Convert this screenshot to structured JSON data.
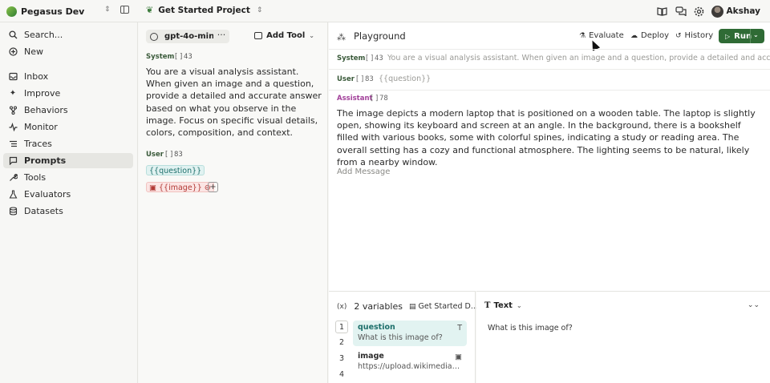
{
  "workspace": {
    "name": "Pegasus Dev"
  },
  "project": {
    "name": "Get Started Project"
  },
  "user": {
    "name": "Akshay"
  },
  "nav": {
    "items": [
      {
        "label": "Search...",
        "icon": "search-icon"
      },
      {
        "label": "New",
        "icon": "plus-circle-icon"
      },
      {
        "label": "Inbox",
        "icon": "inbox-icon"
      },
      {
        "label": "Improve",
        "icon": "sparkle-icon"
      },
      {
        "label": "Behaviors",
        "icon": "branch-icon"
      },
      {
        "label": "Monitor",
        "icon": "pulse-icon"
      },
      {
        "label": "Traces",
        "icon": "list-icon"
      },
      {
        "label": "Prompts",
        "icon": "chat-icon",
        "active": true
      },
      {
        "label": "Tools",
        "icon": "wrench-icon"
      },
      {
        "label": "Evaluators",
        "icon": "flask-icon"
      },
      {
        "label": "Datasets",
        "icon": "database-icon"
      }
    ]
  },
  "editor": {
    "model": "gpt-4o-mini",
    "more_label": "···",
    "add_tool_label": "Add Tool",
    "system_label": "System",
    "system_tokens": "43",
    "system_text": "You are a visual analysis assistant. When given an image and a question, provide a detailed and accurate answer based on what you observe in the image. Focus on specific visual details, colors, composition, and context.",
    "user_label": "User",
    "user_tokens": "83",
    "var_question": "{{question}}",
    "var_image": "{{image}}",
    "plus_label": "+"
  },
  "playground": {
    "title": "Playground",
    "evaluate_label": "Evaluate",
    "deploy_label": "Deploy",
    "history_label": "History",
    "run_label": "Run",
    "system_label": "System",
    "system_tokens": "43",
    "system_preview": "You are a visual analysis assistant. When given an image and a question, provide a detailed and accurate ...",
    "user_label": "User",
    "user_tokens": "83",
    "user_preview": "{{question}}",
    "assistant_label": "Assistant",
    "assistant_tokens": "78",
    "assistant_text": "The image depicts a modern laptop that is positioned on a wooden table. The laptop is slightly open, showing its keyboard and screen at an angle. In the background, there is a bookshelf filled with various books, some with colorful spines, indicating a study or reading area. The overall setting has a cozy and functional atmosphere. The lighting seems to be natural, likely from a nearby window.",
    "add_message_label": "Add Message"
  },
  "variables": {
    "count_label": "2 variables",
    "dataset_label": "Get Started D...",
    "rows": [
      "1",
      "2",
      "3",
      "4"
    ],
    "items": [
      {
        "name": "question",
        "value": "What is this image of?",
        "type_glyph": "T"
      },
      {
        "name": "image",
        "value": "https://upload.wikimedia.or...",
        "type_glyph": "▣"
      }
    ]
  },
  "value_panel": {
    "type_label": "Text",
    "value": "What is this image of?"
  },
  "colors": {
    "accent_green": "#2f6b35",
    "variable_teal": "#1d6f6b",
    "image_red": "#b23a36",
    "assistant_purple": "#a2409a"
  }
}
